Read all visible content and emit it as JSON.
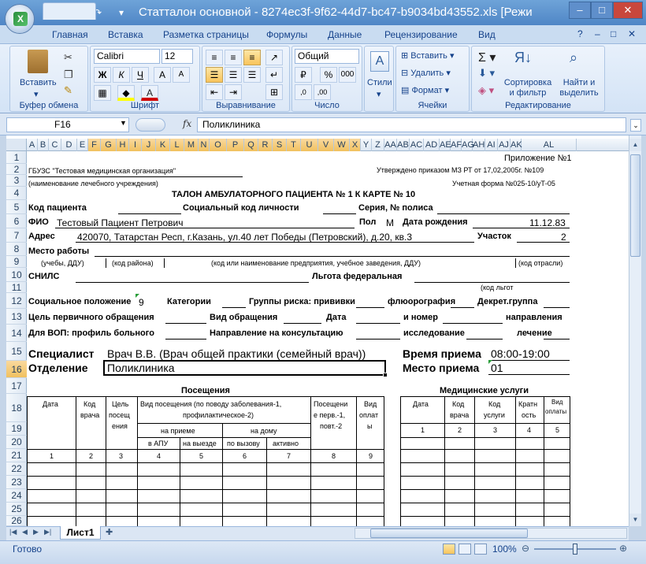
{
  "window": {
    "title": "Статталон основной - 8274ec3f-9f62-44d7-bc47-b9034bd43552.xls  [Режи",
    "minimize": "–",
    "maximize": "□",
    "close": "✕"
  },
  "ribbon": {
    "tabs": [
      "Главная",
      "Вставка",
      "Разметка страницы",
      "Формулы",
      "Данные",
      "Рецензирование",
      "Вид"
    ],
    "clipboard": {
      "paste": "Вставить",
      "group": "Буфер обмена"
    },
    "font": {
      "name": "Calibri",
      "size": "12",
      "bold": "Ж",
      "italic": "К",
      "underline": "Ч",
      "group": "Шрифт"
    },
    "alignment": {
      "group": "Выравнивание"
    },
    "number": {
      "format": "Общий",
      "percent": "%",
      "thousands": "000",
      "group": "Число"
    },
    "styles": {
      "label": "Стили"
    },
    "cells": {
      "insert": "Вставить",
      "delete": "Удалить",
      "format": "Формат",
      "group": "Ячейки"
    },
    "editing": {
      "sort": "Сортировка и фильтр",
      "find": "Найти и выделить",
      "group": "Редактирование"
    }
  },
  "formula_bar": {
    "cell": "F16",
    "fx": "fx",
    "value": "Поликлиника"
  },
  "columns": [
    "A",
    "B",
    "C",
    "D",
    "E",
    "F",
    "G",
    "H",
    "I",
    "J",
    "K",
    "L",
    "M",
    "N",
    "O",
    "P",
    "Q",
    "R",
    "S",
    "T",
    "U",
    "V",
    "W",
    "X",
    "Y",
    "Z",
    "AA",
    "AB",
    "AC",
    "AD",
    "AE",
    "AF",
    "AG",
    "AH",
    "AI",
    "AJ",
    "AK",
    "AL"
  ],
  "rows": [
    "1",
    "2",
    "3",
    "4",
    "5",
    "6",
    "7",
    "8",
    "9",
    "10",
    "11",
    "12",
    "13",
    "14",
    "15",
    "16",
    "17",
    "18",
    "19",
    "20",
    "21",
    "22",
    "23",
    "24",
    "25",
    "26"
  ],
  "form": {
    "r1": "Приложение №1",
    "r2a": "ГБУЗС \"Тестовая медицинская организация\"",
    "r2b": "Утверждено приказом МЗ РТ от 17,02,2005г. №109",
    "r3a": "(наименование лечебного учреждения)",
    "r3b": "Учетная форма №025-10/уТ-05",
    "r4": "ТАЛОН АМБУЛАТОРНОГО ПАЦИЕНТА № 1  К КАРТЕ № 10",
    "r5a": "Код пациента",
    "r5b": "Социальный код личности",
    "r5c": "Серия, № полиса",
    "r6a": "ФИО",
    "r6b": "Тестовый Пациент Петрович",
    "r6c": "Пол",
    "r6d": "М",
    "r6e": "Дата рождения",
    "r6f": "11.12.83",
    "r7a": "Адрес",
    "r7b": "420070, Татарстан Респ, г.Казань, ул.40 лет Победы (Петровский), д.20, кв.3",
    "r7c": "Участок",
    "r7d": "2",
    "r8": "Место работы",
    "r9a": "(учебы, ДДУ)",
    "r9b": "(код района)",
    "r9c": "(код или наименование предприятия, учебное заведения, ДДУ)",
    "r9d": "(код отрасли)",
    "r10a": "СНИЛС",
    "r10b": "Льгота федеральная",
    "r11": "(код льгот",
    "r12a": "Социальное положение",
    "r12b": "9",
    "r12c": "Категории",
    "r12d": "Группы риска: прививки",
    "r12e": "флюорография",
    "r12f": "Декрет.группа",
    "r13a": "Цель первичного обращения",
    "r13b": "Вид обращения",
    "r13c": "Дата",
    "r13d": "и номер",
    "r13e": "направления",
    "r14a": "Для ВОП: профиль больного",
    "r14b": "Направление на консультацию",
    "r14c": "исследование",
    "r14d": "лечение",
    "r15a": "Специалист",
    "r15b": "Врач В.В. (Врач общей практики (семейный врач))",
    "r15c": "Время приема",
    "r15d": "08:00-19:00",
    "r16a": "Отделение",
    "r16b": "Поликлиника",
    "r16c": "Место приема",
    "r16d": "01",
    "r17a": "Посещения",
    "r17b": "Медицинские услуги",
    "h_date": "Дата",
    "h_code1": "Код",
    "h_code2": "врача",
    "h_goal1": "Цель",
    "h_goal2": "посещ",
    "h_goal3": "ения",
    "h_kind1": "Вид посещения",
    "h_kind2": "(по поводу заболевания-1,",
    "h_kind3": "профилактическое-2)",
    "h_first1": "Посещени",
    "h_first2": "е перв.-1,",
    "h_first3": "повт.-2",
    "h_pay1": "Вид",
    "h_pay2": "оплат",
    "h_pay3": "ы",
    "h_reception": "на приеме",
    "h_home": "на дому",
    "h_apu": "в АПУ",
    "h_visit": "на выезде",
    "h_call": "по вызову",
    "h_active": "активно",
    "s_date": "Дата",
    "s_code1": "Код",
    "s_code2": "врача",
    "s_svc1": "Код",
    "s_svc2": "услуги",
    "s_mult1": "Кратн",
    "s_mult2": "ость",
    "s_pay1": "Вид",
    "s_pay2": "оплаты",
    "nums_left": [
      "1",
      "2",
      "3",
      "4",
      "5",
      "6",
      "7",
      "8",
      "9"
    ],
    "nums_right": [
      "1",
      "2",
      "3",
      "4",
      "5"
    ]
  },
  "sheet_tabs": {
    "active": "Лист1"
  },
  "status": {
    "ready": "Готово",
    "zoom": "100%"
  }
}
